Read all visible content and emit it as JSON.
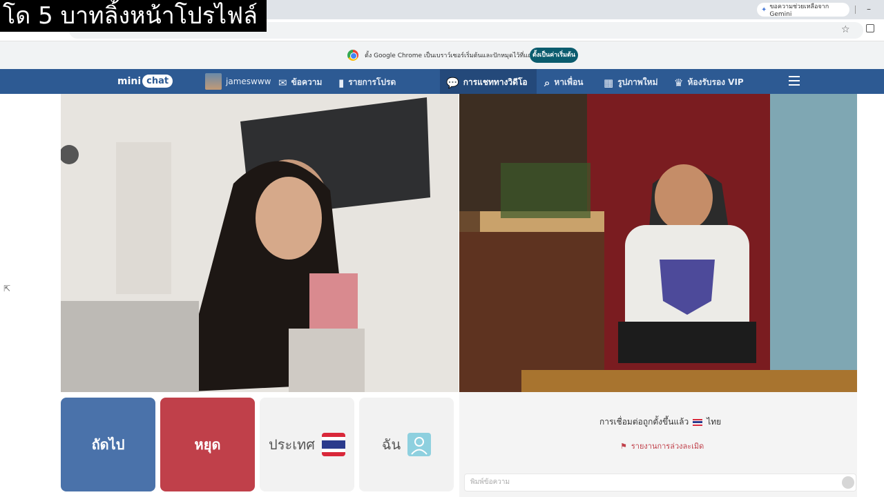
{
  "caption": "โด 5 บาทลิ้งหน้าโปรไฟล์",
  "browser": {
    "gemini_chip": "ขอความช่วยเหลือจาก Gemini",
    "minimize": "–",
    "infobar_text": "ตั้ง Google Chrome เป็นเบราว์เซอร์เริ่มต้นและปักหมุดไว้ที่แถบงาน",
    "infobar_button": "ตั้งเป็นค่าเริ่มต้น"
  },
  "site": {
    "logo_text_1": "mini",
    "logo_text_2": "chat",
    "nav": {
      "username": "jameswww",
      "messages": "ข้อความ",
      "favorites": "รายการโปรด",
      "video_chat": "การแชททางวิดีโอ",
      "find_friends": "หาเพื่อน",
      "new_photos": "รูปภาพใหม่",
      "vip_room": "ห้องรับรอง VIP"
    }
  },
  "controls": {
    "next": "ถัดไป",
    "stop": "หยุด",
    "country": "ประเทศ",
    "me": "ฉัน"
  },
  "chat": {
    "connection": "การเชื่อมต่อถูกตั้งขึ้นแล้ว",
    "country": "ไทย",
    "report": "รายงานการล่วงละเมิด",
    "input_placeholder": "พิมพ์ข้อความ"
  },
  "colors": {
    "nav_bg": "#2d5a93",
    "next_bg": "#4a72aa",
    "stop_bg": "#c0404a"
  }
}
